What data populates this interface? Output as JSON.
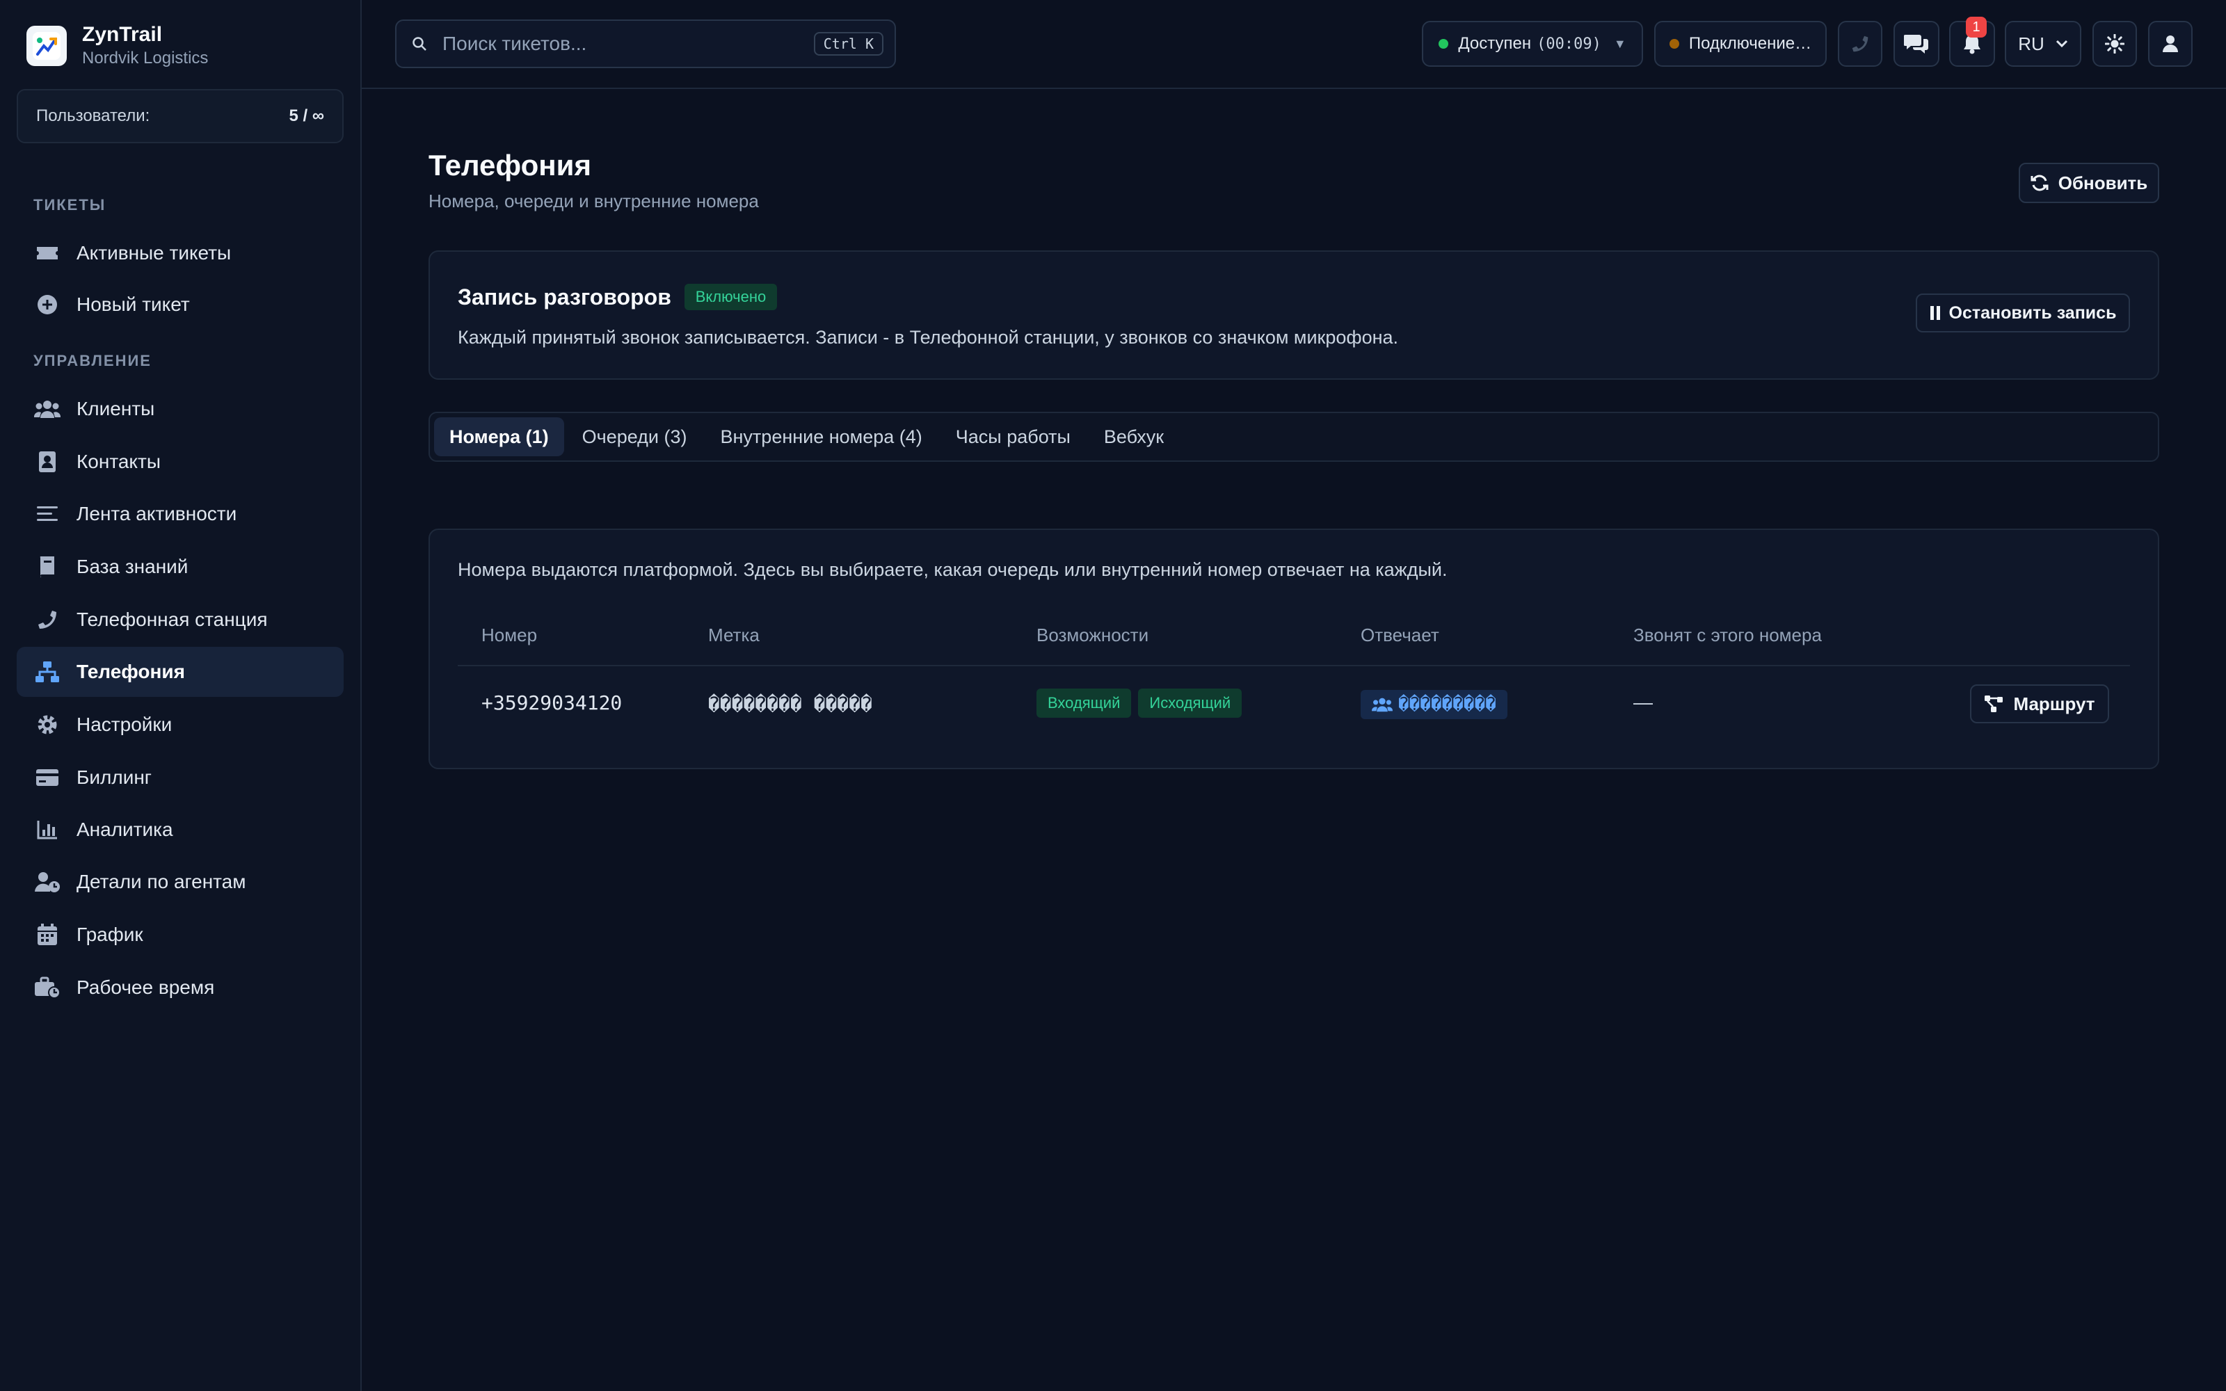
{
  "brand": {
    "name": "ZynTrail",
    "org": "Nordvik Logistics"
  },
  "users": {
    "label": "Пользователи:",
    "value": "5 / ∞"
  },
  "sidebar": {
    "section_tickets": "ТИКЕТЫ",
    "section_manage": "УПРАВЛЕНИЕ",
    "items": [
      {
        "label": "Активные тикеты",
        "icon": "ticket-icon"
      },
      {
        "label": "Новый тикет",
        "icon": "plus-circle-icon"
      },
      {
        "label": "Клиенты",
        "icon": "users-icon"
      },
      {
        "label": "Контакты",
        "icon": "contact-card-icon"
      },
      {
        "label": "Лента активности",
        "icon": "list-icon"
      },
      {
        "label": "База знаний",
        "icon": "book-icon"
      },
      {
        "label": "Телефонная станция",
        "icon": "phone-icon"
      },
      {
        "label": "Телефония",
        "icon": "network-icon",
        "active": true
      },
      {
        "label": "Настройки",
        "icon": "gear-icon"
      },
      {
        "label": "Биллинг",
        "icon": "credit-card-icon"
      },
      {
        "label": "Аналитика",
        "icon": "bar-chart-icon"
      },
      {
        "label": "Детали по агентам",
        "icon": "user-clock-icon"
      },
      {
        "label": "График",
        "icon": "calendar-icon"
      },
      {
        "label": "Рабочее время",
        "icon": "briefcase-clock-icon"
      }
    ]
  },
  "topbar": {
    "search_placeholder": "Поиск тикетов...",
    "search_shortcut": "Ctrl K",
    "status_label": "Доступен",
    "status_timer": "(00:09)",
    "connection_label": "Подключение…",
    "notifications_count": "1",
    "language": "RU",
    "status_color": "#22c55e",
    "connection_color": "#a16207"
  },
  "page": {
    "title": "Телефония",
    "subtitle": "Номера, очереди и внутренние номера",
    "refresh_label": "Обновить"
  },
  "recording": {
    "title": "Запись разговоров",
    "badge": "Включено",
    "description": "Каждый принятый звонок записывается. Записи - в Телефонной станции, у звонков со значком микрофона.",
    "stop_label": "Остановить запись"
  },
  "tabs": [
    {
      "label": "Номера (1)",
      "active": true
    },
    {
      "label": "Очереди (3)"
    },
    {
      "label": "Внутренние номера (4)"
    },
    {
      "label": "Часы работы"
    },
    {
      "label": "Вебхук"
    }
  ],
  "numbers": {
    "info": "Номера выдаются платформой. Здесь вы выбираете, какая очередь или внутренний номер отвечает на каждый.",
    "columns": [
      "Номер",
      "Метка",
      "Возможности",
      "Отвечает",
      "Звонят с этого номера"
    ],
    "rows": [
      {
        "number": "+35929034120",
        "label": "�������� �����",
        "capabilities": [
          "Входящий",
          "Исходящий"
        ],
        "answers": "���������",
        "caller_id": "—",
        "route_label": "Маршрут"
      }
    ]
  }
}
